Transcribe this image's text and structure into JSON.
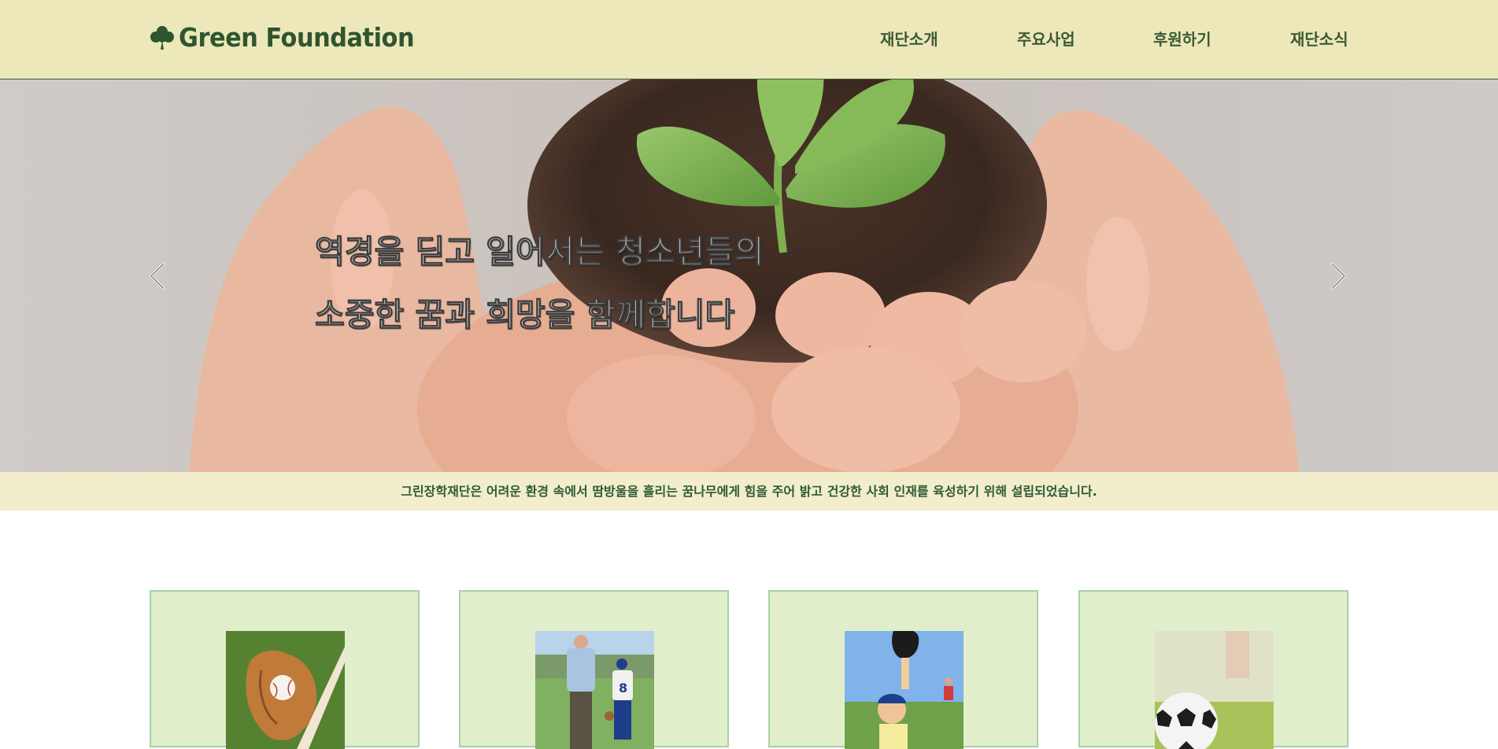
{
  "header": {
    "logo_text": "Green Foundation",
    "logo_icon": "clover-icon",
    "nav": [
      {
        "label": "재단소개"
      },
      {
        "label": "주요사업"
      },
      {
        "label": "후원하기"
      },
      {
        "label": "재단소식"
      }
    ]
  },
  "hero": {
    "line1": "역경을 딛고 일어서는 청소년들의",
    "line2": "소중한 꿈과 희망을 함께합니다",
    "prev_icon": "chevron-left-icon",
    "next_icon": "chevron-right-icon"
  },
  "intro": {
    "text": "그린장학재단은 어려운 환경 속에서 땀방울을 흘리는 꿈나무에게 힘을 주어 밝고 건강한 사회 인재를 육성하기 위해 설립되었습니다."
  },
  "cards": [
    {
      "image": "baseball-glove-image"
    },
    {
      "image": "father-son-baseball-image"
    },
    {
      "image": "boy-baseball-catch-image"
    },
    {
      "image": "soccer-ball-image"
    }
  ],
  "colors": {
    "header_bg": "#ede8b9",
    "brand_green": "#2f5530",
    "intro_bg": "#f2eecc",
    "card_bg": "#e1eecc",
    "card_border": "#a7d1a8"
  }
}
